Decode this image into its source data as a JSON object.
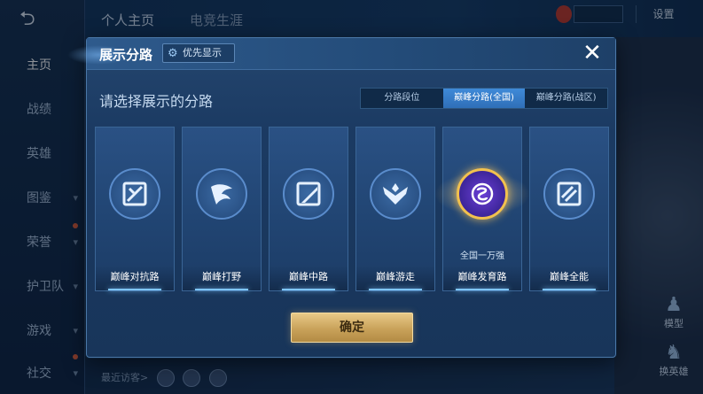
{
  "sidebar": {
    "back_glyph": "⮌",
    "items": [
      {
        "label": "主页",
        "active": true,
        "chevron": false
      },
      {
        "label": "战绩",
        "active": false,
        "chevron": false
      },
      {
        "label": "英雄",
        "active": false,
        "chevron": false
      },
      {
        "label": "图鉴",
        "active": false,
        "chevron": true
      },
      {
        "label": "荣誉",
        "active": false,
        "chevron": true
      },
      {
        "label": "护卫队",
        "active": false,
        "chevron": true
      },
      {
        "label": "游戏",
        "active": false,
        "chevron": true
      },
      {
        "label": "社交",
        "active": false,
        "chevron": true
      }
    ]
  },
  "topbar": {
    "tabs": [
      "个人主页",
      "电竞生涯"
    ],
    "settings_label": "设置"
  },
  "right_panel": {
    "model_label": "模型",
    "hero_label": "换英雄"
  },
  "bottom": {
    "recent_visitors_label": "最近访客>"
  },
  "modal": {
    "title": "展示分路",
    "pref_label": "优先显示",
    "close_glyph": "✕",
    "subtitle": "请选择展示的分路",
    "seg_tabs": [
      "分路段位",
      "巅峰分路(全国)",
      "巅峰分路(战区)"
    ],
    "seg_active_index": 1,
    "cards": [
      {
        "label": "巅峰对抗路",
        "icon": "clash-lane-icon",
        "sub": ""
      },
      {
        "label": "巅峰打野",
        "icon": "jungle-icon",
        "sub": ""
      },
      {
        "label": "巅峰中路",
        "icon": "mid-lane-icon",
        "sub": ""
      },
      {
        "label": "巅峰游走",
        "icon": "roam-icon",
        "sub": ""
      },
      {
        "label": "巅峰发育路",
        "icon": "farm-lane-gold-icon",
        "sub": "全国一万强"
      },
      {
        "label": "巅峰全能",
        "icon": "all-round-icon",
        "sub": ""
      }
    ],
    "confirm_label": "确定"
  },
  "colors": {
    "accent_blue": "#2f6fb8",
    "gold": "#c9a25a"
  }
}
